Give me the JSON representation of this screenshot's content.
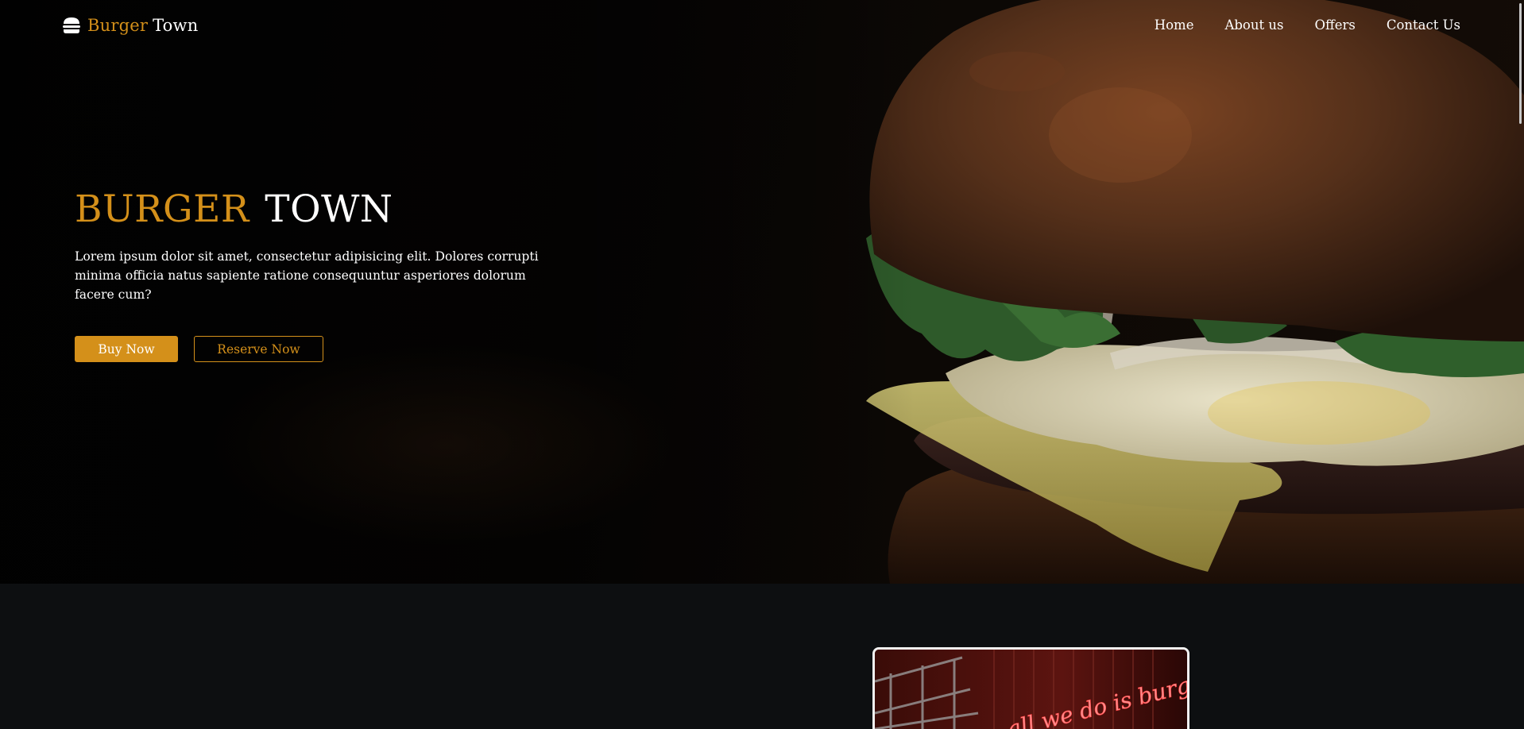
{
  "navbar": {
    "brand": {
      "icon": "burger-icon",
      "word_a": "Burger",
      "word_b": "Town"
    },
    "links": [
      "Home",
      "About us",
      "Offers",
      "Contact Us"
    ]
  },
  "hero": {
    "title_a": "BURGER",
    "title_b": "TOWN",
    "text": "Lorem ipsum dolor sit amet, consectetur adipisicing elit. Dolores corrupti minima officia natus sapiente ratione consequuntur asperiores dolorum facere cum?",
    "buttons": {
      "primary": "Buy Now",
      "secondary": "Reserve Now"
    }
  },
  "section_two": {
    "neon_sign_text": "all we do is burger"
  },
  "colors": {
    "accent": "#d4901a",
    "background": "#0d0f11",
    "text": "#ffffff"
  }
}
